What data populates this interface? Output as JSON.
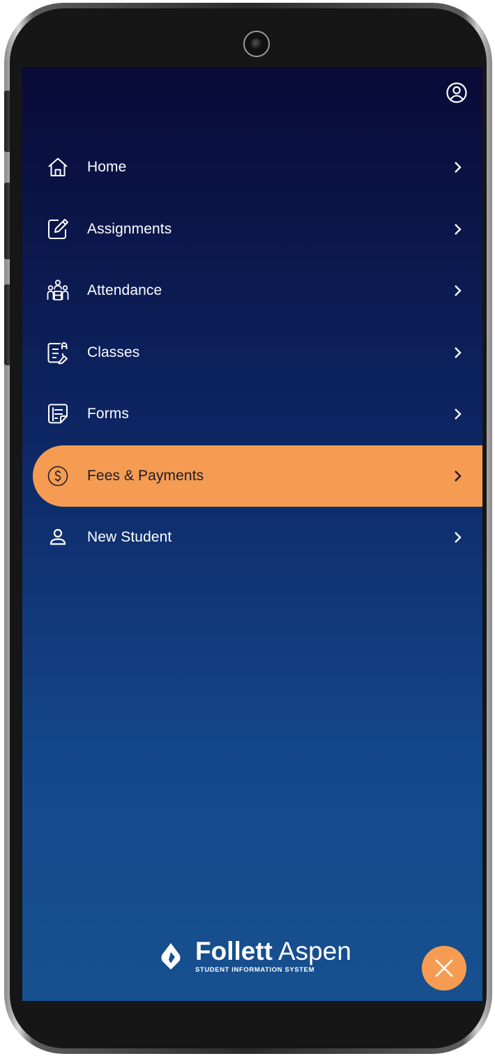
{
  "menu": {
    "items": [
      {
        "label": "Home",
        "icon": "home-icon",
        "active": false
      },
      {
        "label": "Assignments",
        "icon": "edit-note-icon",
        "active": false
      },
      {
        "label": "Attendance",
        "icon": "people-group-icon",
        "active": false
      },
      {
        "label": "Classes",
        "icon": "class-document-icon",
        "active": false
      },
      {
        "label": "Forms",
        "icon": "form-list-icon",
        "active": false
      },
      {
        "label": "Fees & Payments",
        "icon": "dollar-circle-icon",
        "active": true
      },
      {
        "label": "New Student",
        "icon": "person-icon",
        "active": false
      }
    ]
  },
  "brand": {
    "name_bold": "Follett",
    "name_light": "Aspen",
    "tagline": "STUDENT INFORMATION SYSTEM"
  },
  "colors": {
    "accent": "#f59c52",
    "background_top": "#090a36",
    "background_bottom": "#17508f"
  }
}
